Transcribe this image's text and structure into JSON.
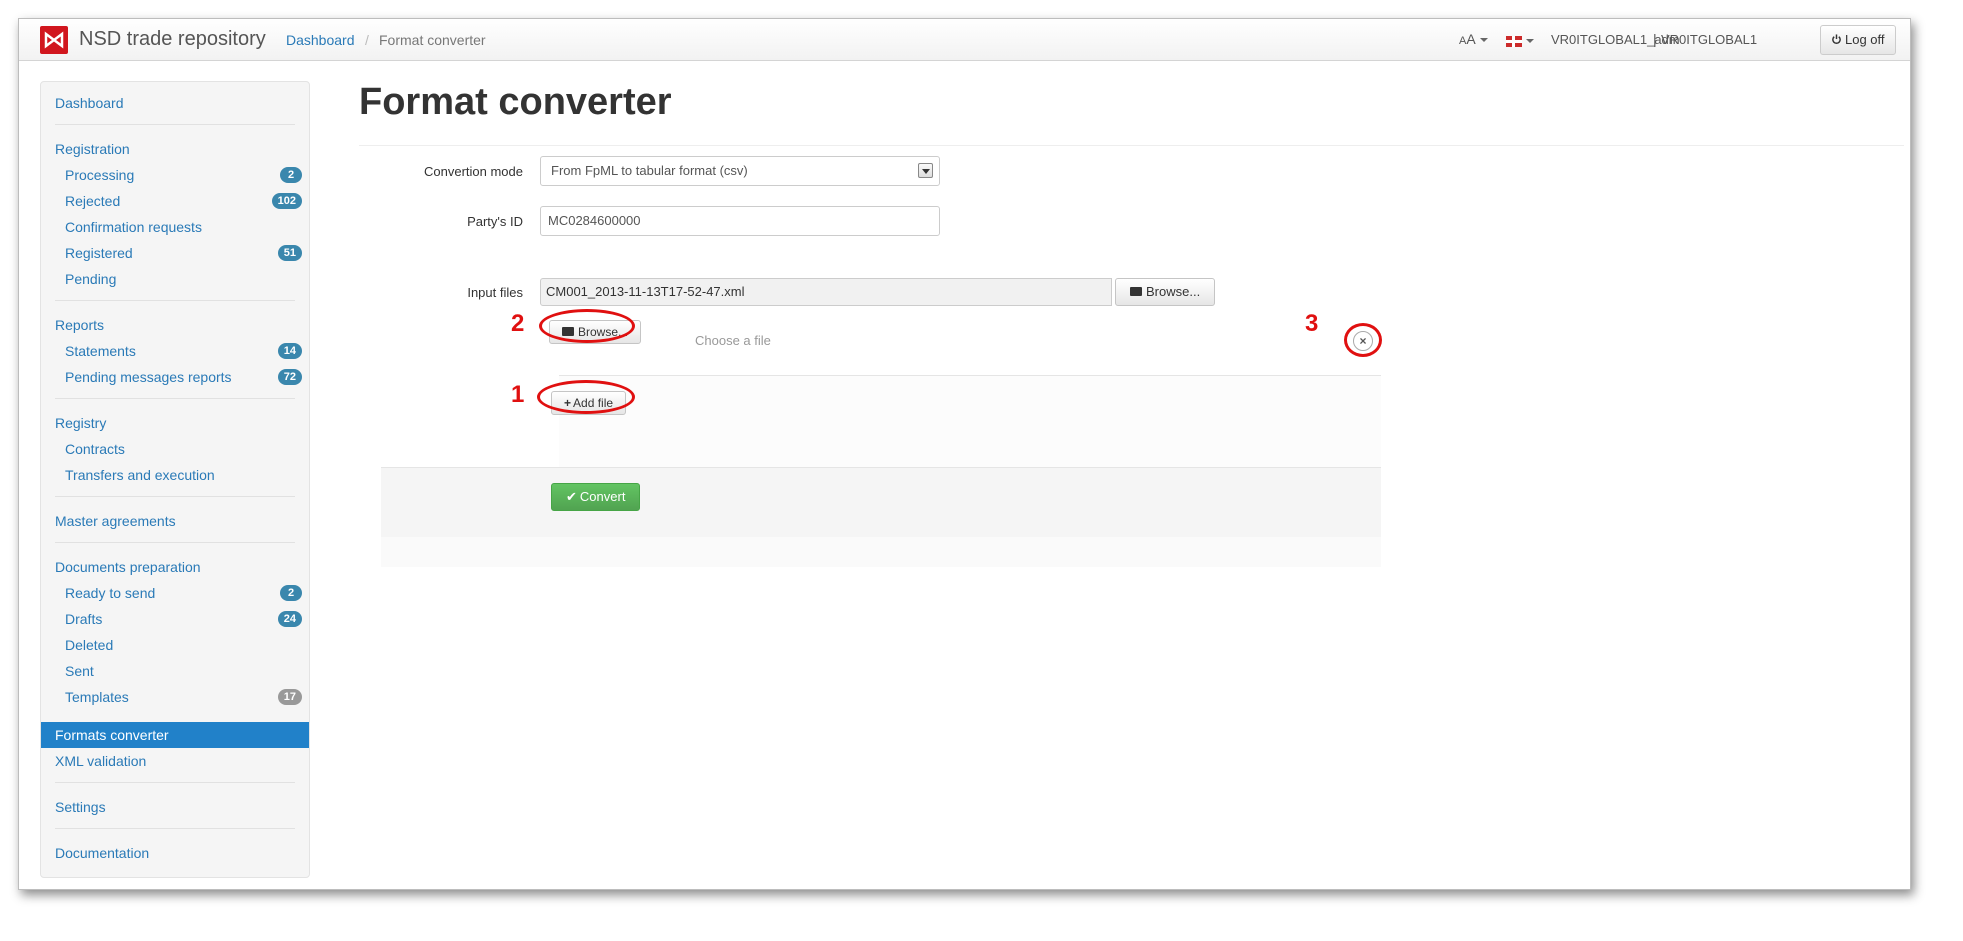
{
  "app": {
    "brand": "NSD trade repository",
    "breadcrumb": {
      "link": "Dashboard",
      "separator": "/",
      "current": "Format converter"
    }
  },
  "header": {
    "font_toggle": {
      "small": "A",
      "large": "A"
    },
    "language_icon": "uk-flag-icon",
    "user": "VR0ITGLOBAL1_adm",
    "user_separator": "|",
    "org": "VR0ITGLOBAL1",
    "logoff_label": "Log off",
    "logoff_icon": "power-icon"
  },
  "sidebar": {
    "dashboard": "Dashboard",
    "registration": {
      "title": "Registration",
      "items": [
        {
          "label": "Processing",
          "badge": "2"
        },
        {
          "label": "Rejected",
          "badge": "102"
        },
        {
          "label": "Confirmation requests",
          "badge": ""
        },
        {
          "label": "Registered",
          "badge": "51"
        },
        {
          "label": "Pending",
          "badge": ""
        }
      ]
    },
    "reports": {
      "title": "Reports",
      "items": [
        {
          "label": "Statements",
          "badge": "14"
        },
        {
          "label": "Pending messages reports",
          "badge": "72"
        }
      ]
    },
    "registry": {
      "title": "Registry",
      "items": [
        {
          "label": "Contracts"
        },
        {
          "label": "Transfers and execution"
        }
      ]
    },
    "master_agreements": "Master agreements",
    "documents_preparation": {
      "title": "Documents preparation",
      "items": [
        {
          "label": "Ready to send",
          "badge": "2"
        },
        {
          "label": "Drafts",
          "badge": "24"
        },
        {
          "label": "Deleted",
          "badge": ""
        },
        {
          "label": "Sent",
          "badge": ""
        },
        {
          "label": "Templates",
          "badge": "17"
        }
      ]
    },
    "formats_converter": "Formats converter",
    "xml_validation": "XML validation",
    "settings": "Settings",
    "documentation": "Documentation"
  },
  "main": {
    "title": "Format converter",
    "form": {
      "mode_label": "Convertion mode",
      "mode_value": "From FpML to tabular format (csv)",
      "party_label": "Party's ID",
      "party_value": "MC0284600000",
      "files_label": "Input files",
      "file1_name": "CM001_2013-11-13T17-52-47.xml",
      "browse_label": "Browse...",
      "browse2_label": "Browse...",
      "choose_placeholder": "Choose a file",
      "remove_symbol": "×",
      "add_file_label": "Add file",
      "convert_label": "Convert"
    },
    "annotations": [
      "1",
      "2",
      "3"
    ]
  },
  "colors": {
    "link": "#2a7ab7",
    "active_nav": "#2181c9",
    "badge": "#3a87ad",
    "badge_gray": "#999999",
    "success": "#5bb75b",
    "annotation": "#e01010",
    "brand": "#d1161e"
  }
}
